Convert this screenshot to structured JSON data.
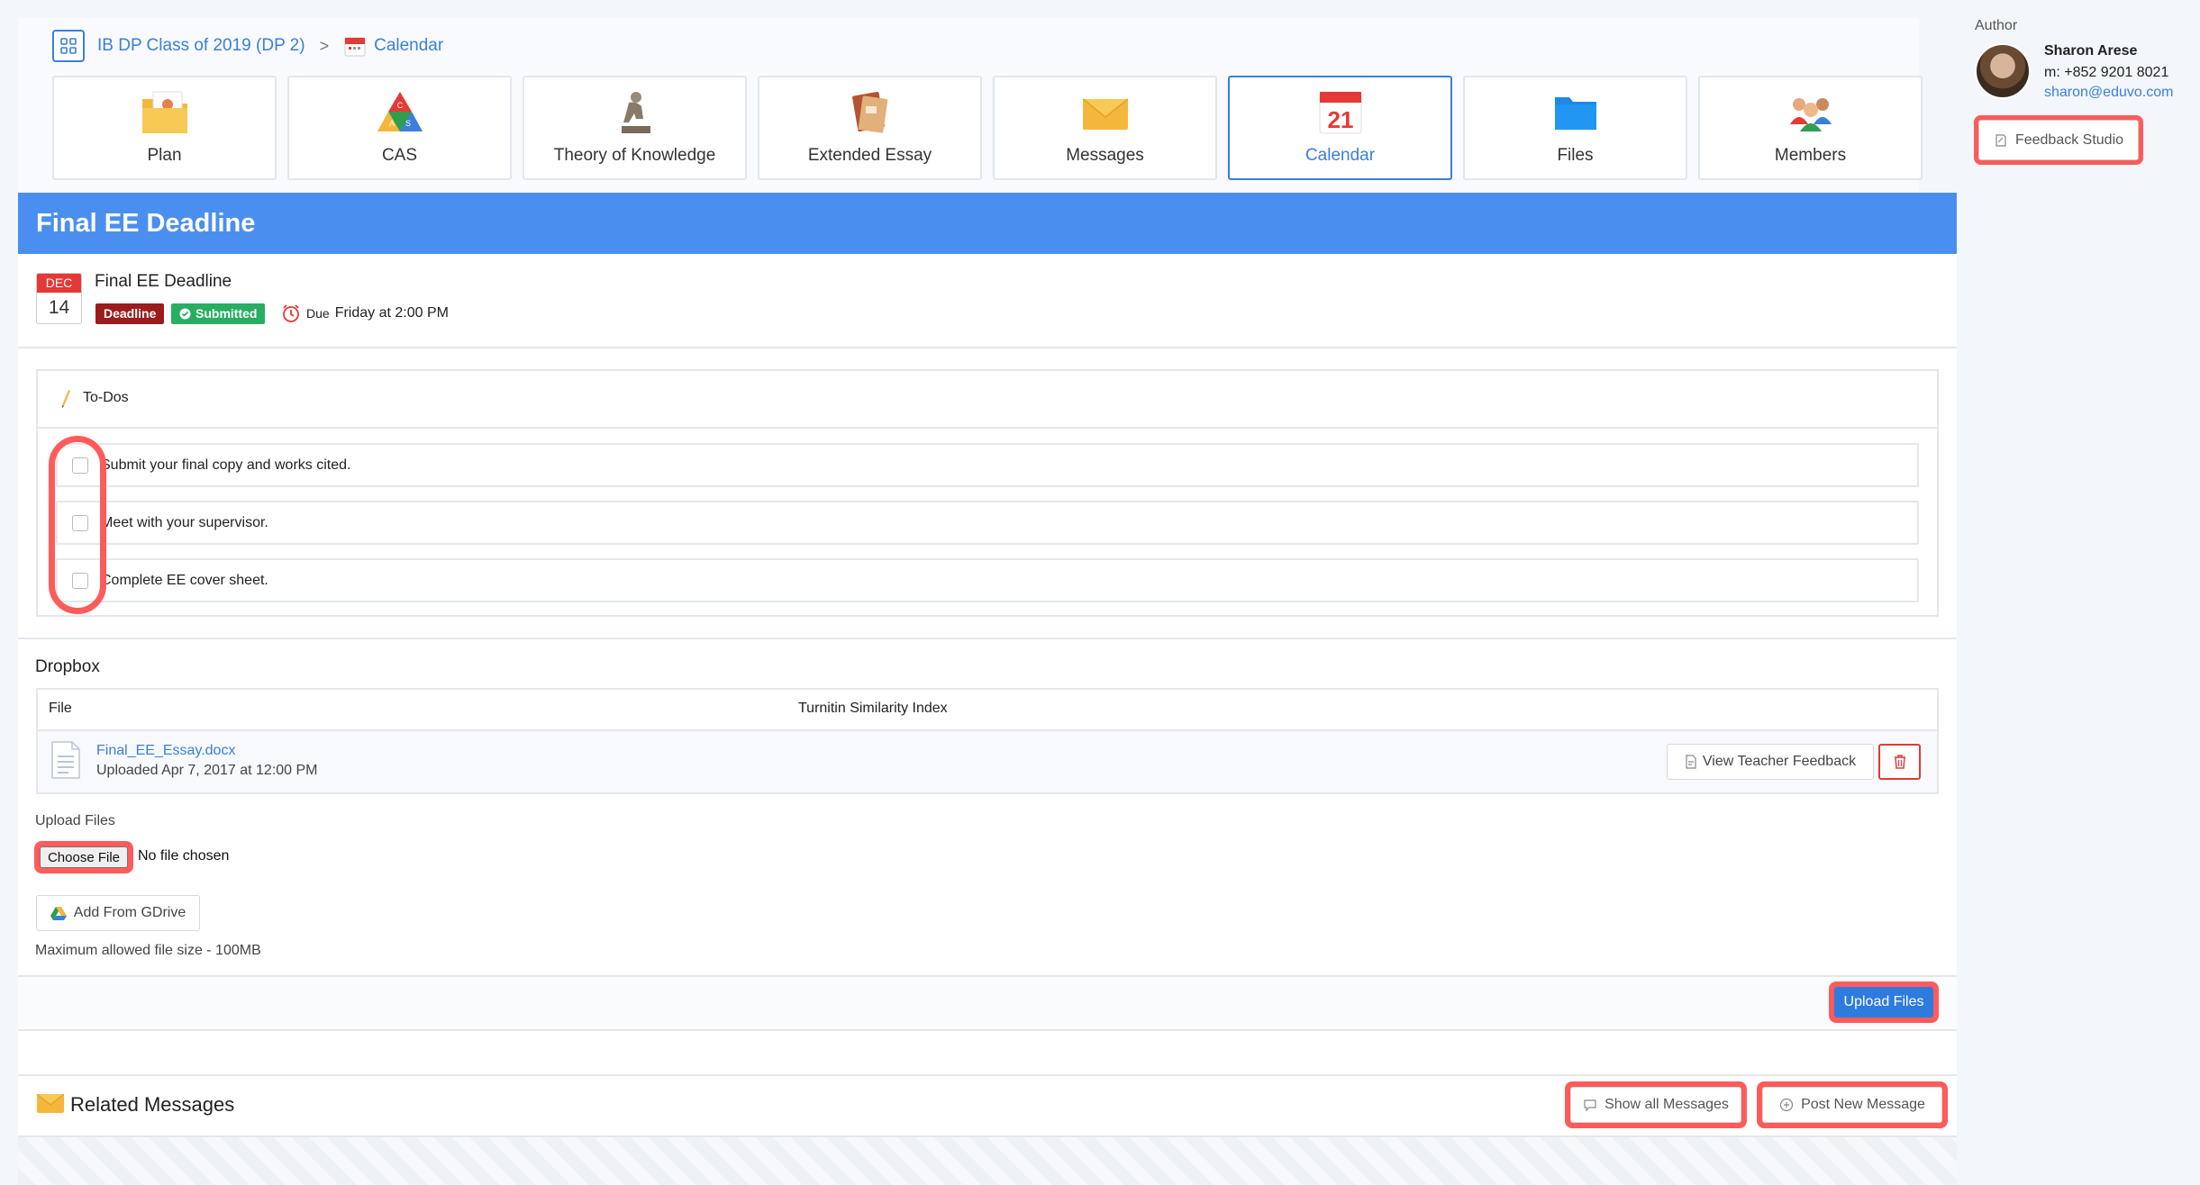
{
  "breadcrumb": {
    "class_name": "IB DP Class of 2019 (DP 2)",
    "separator": ">",
    "current": "Calendar"
  },
  "tabs": [
    {
      "label": "Plan",
      "icon": "plan-icon"
    },
    {
      "label": "CAS",
      "icon": "cas-icon"
    },
    {
      "label": "Theory of Knowledge",
      "icon": "thinker-icon"
    },
    {
      "label": "Extended Essay",
      "icon": "book-icon"
    },
    {
      "label": "Messages",
      "icon": "envelope-icon"
    },
    {
      "label": "Calendar",
      "icon": "calendar-icon",
      "active": true
    },
    {
      "label": "Files",
      "icon": "folder-icon"
    },
    {
      "label": "Members",
      "icon": "members-icon"
    }
  ],
  "calendar_icon_day": "21",
  "cas_letters": [
    "C",
    "A",
    "S"
  ],
  "author": {
    "label": "Author",
    "name": "Sharon Arese",
    "phone": "m: +852 9201 8021",
    "email": "sharon@eduvo.com",
    "feedback_button": "Feedback Studio"
  },
  "event": {
    "header": "Final EE Deadline",
    "month": "DEC",
    "day": "14",
    "title": "Final EE Deadline",
    "badge_deadline": "Deadline",
    "badge_submitted": "Submitted",
    "due_label": "Due",
    "due_value": "Friday at 2:00 PM"
  },
  "todos": {
    "title": "To-Dos",
    "items": [
      "Submit your final copy and works cited.",
      "Meet with your supervisor.",
      "Complete EE cover sheet."
    ]
  },
  "dropbox": {
    "title": "Dropbox",
    "col_file": "File",
    "col_similarity": "Turnitin Similarity Index",
    "file_name": "Final_EE_Essay.docx",
    "file_uploaded": "Uploaded Apr 7, 2017 at 12:00 PM",
    "view_feedback": "View Teacher Feedback",
    "upload_label": "Upload Files",
    "choose_file": "Choose File",
    "no_file": "No file chosen",
    "gdrive": "Add From GDrive",
    "max_size": "Maximum allowed file size - 100MB",
    "upload_button": "Upload Files"
  },
  "related": {
    "title": "Related Messages",
    "show_all": "Show all Messages",
    "post_new": "Post New Message"
  },
  "colors": {
    "accent": "#3b7fd9",
    "header_bar": "#4a8ff0",
    "deadline": "#9b1c1c",
    "submitted": "#27ae60",
    "highlight": "#ff5b5b"
  }
}
